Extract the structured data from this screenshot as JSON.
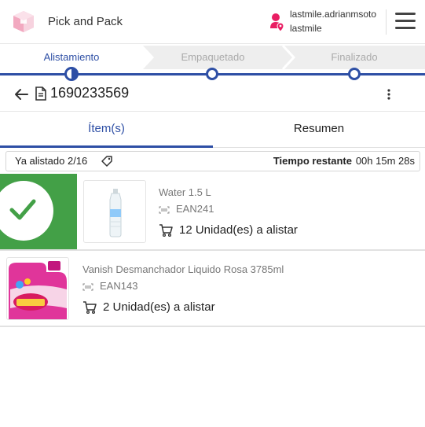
{
  "header": {
    "app_title": "Pick and Pack",
    "user_name": "lastmile.adrianmsoto",
    "user_org": "lastmile"
  },
  "stepper": {
    "steps": [
      {
        "label": "Alistamiento",
        "state": "active"
      },
      {
        "label": "Empaquetado",
        "state": "pending"
      },
      {
        "label": "Finalizado",
        "state": "pending"
      }
    ]
  },
  "order": {
    "number": "1690233569"
  },
  "tabs": [
    {
      "label": "Ítem(s)",
      "active": true
    },
    {
      "label": "Resumen",
      "active": false
    }
  ],
  "summary": {
    "picked": "Ya alistado 2/16",
    "time_label": "Tiempo restante",
    "time_value": "00h 15m 28s"
  },
  "items": [
    {
      "name": "Water 1.5 L",
      "ean": "EAN241",
      "quantity": "12 Unidad(es) a alistar",
      "picked": true
    },
    {
      "name": "Vanish Desmanchador Liquido Rosa 3785ml",
      "ean": "EAN143",
      "quantity": "2 Unidad(es) a alistar",
      "picked": false
    }
  ],
  "colors": {
    "primary": "#2e4fa5",
    "success": "#43a047",
    "accent_pink": "#e91e63"
  }
}
